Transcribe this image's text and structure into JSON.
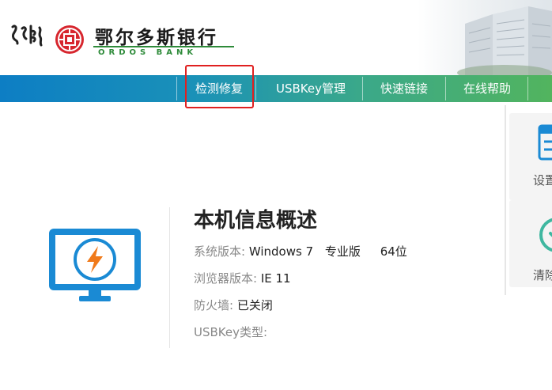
{
  "header": {
    "bank_name_cn": "鄂尔多斯银行",
    "bank_name_en": "ORDOS BANK"
  },
  "nav": {
    "items": [
      "检测修复",
      "USBKey管理",
      "快速链接",
      "在线帮助"
    ],
    "active_index": 0
  },
  "info": {
    "title": "本机信息概述",
    "rows": [
      {
        "label": "系统版本:",
        "values": [
          "Windows 7",
          "专业版",
          "64位"
        ]
      },
      {
        "label": "浏览器版本:",
        "values": [
          "IE 11"
        ]
      },
      {
        "label": "防火墙:",
        "values": [
          "已关闭"
        ]
      },
      {
        "label": "USBKey类型:",
        "values": []
      }
    ]
  },
  "side_panel": {
    "items": [
      "设置",
      "清除"
    ]
  },
  "colors": {
    "nav_start": "#0d7ec4",
    "nav_end": "#52b45e",
    "brand_red": "#d7262e",
    "brand_green": "#2e8b3a",
    "monitor_blue": "#1a8ad4",
    "lightning_orange": "#f07a1a",
    "highlight_red": "#e02020",
    "side_teal": "#3fb7a0"
  },
  "icons": [
    "mongolian-script-logo",
    "bank-emblem-icon",
    "building-photo",
    "monitor-lightning-icon",
    "settings-icon",
    "clean-icon"
  ]
}
